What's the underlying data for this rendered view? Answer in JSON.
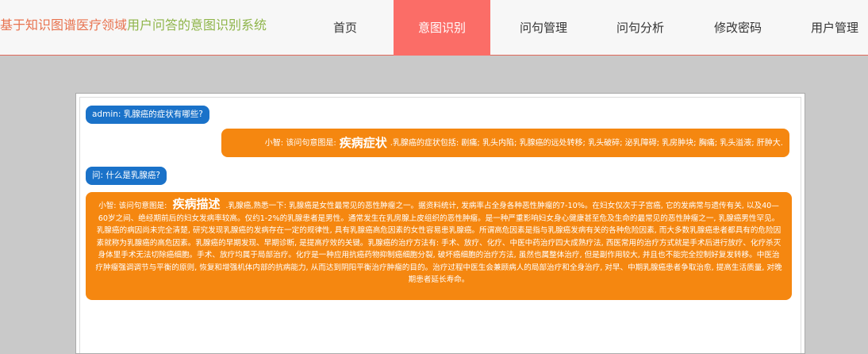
{
  "header": {
    "title_part1": "基于知识图谱医疗领域",
    "title_part2": "用户问答的意图识别系统",
    "nav": [
      {
        "label": "首页"
      },
      {
        "label": "意图识别"
      },
      {
        "label": "问句管理"
      },
      {
        "label": "问句分析"
      },
      {
        "label": "修改密码"
      },
      {
        "label": "用户管理"
      }
    ],
    "active_index": 1
  },
  "chat": {
    "messages": [
      {
        "role": "user",
        "text": "admin: 乳腺癌的症状有哪些?"
      },
      {
        "role": "bot",
        "prefix": "小智: 该问句意图是:",
        "intent": "疾病症状",
        "body": ".乳腺癌的症状包括: 剧痛; 乳头内陷; 乳腺癌的远处转移; 乳头破碎; 泌乳障碍; 乳房肿块; 胸痛; 乳头溢液; 肝肿大."
      },
      {
        "role": "user",
        "text": "问: 什么是乳腺癌?"
      },
      {
        "role": "bot",
        "prefix": "小智: 该问句意图是:",
        "intent": "疾病描述",
        "body": ".乳腺癌,熟悉一下: 乳腺癌是女性最常见的恶性肿瘤之一。据资料统计, 发病率占全身各种恶性肿瘤的7-10%。在妇女仅次于子宫癌, 它的发病常与遗传有关, 以及40—60岁之间、绝经期前后的妇女发病率较高。仅约1-2%的乳腺患者是男性。通常发生在乳房腺上皮组织的恶性肿瘤。是一种严重影响妇女身心健康甚至危及生命的最常见的恶性肿瘤之一, 乳腺癌男性罕见。乳腺癌的病因尚未完全清楚, 研究发现乳腺癌的发病存在一定的规律性, 具有乳腺癌高危因素的女性容易患乳腺癌。所谓高危因素是指与乳腺癌发病有关的各种危险因素, 而大多数乳腺癌患者都具有的危险因素就称为乳腺癌的高危因素。乳腺癌的早期发现、早期诊断, 是提高疗效的关键。乳腺癌的治疗方法有: 手术、放疗、化疗、中医中药治疗四大成熟疗法, 西医常用的治疗方式就是手术后进行放疗、化疗杀灭身体里手术无法切除癌细胞。手术、放疗均属于局部治疗。化疗是一种应用抗癌药物抑制癌细胞分裂, 破坏癌细胞的治疗方法, 虽然也属整体治疗, 但是副作用较大, 并且也不能完全控制好复发转移。中医治疗肿瘤强调调节与平衡的原则, 恢复和增强机体内部的抗病能力, 从而达到阴阳平衡治疗肿瘤的目的。治疗过程中医生会兼顾病人的局部治疗和全身治疗, 对早、中期乳腺癌患者争取治愈, 提高生活质量, 对晚期患者延长寿命。"
      }
    ]
  }
}
